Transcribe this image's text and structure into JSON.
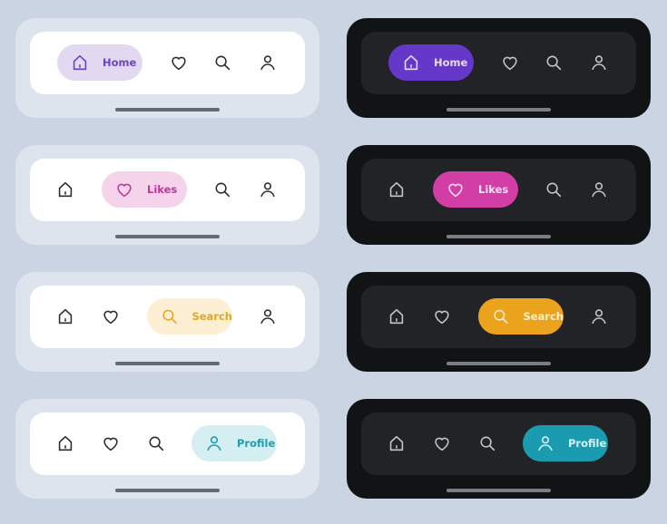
{
  "nav_items": [
    {
      "key": "home",
      "label": "Home",
      "icon": "home-icon"
    },
    {
      "key": "likes",
      "label": "Likes",
      "icon": "heart-icon"
    },
    {
      "key": "search",
      "label": "Search",
      "icon": "search-icon"
    },
    {
      "key": "profile",
      "label": "Profile",
      "icon": "user-icon"
    }
  ],
  "variants": [
    {
      "theme": "light",
      "active": "home",
      "accent": "#6a45b8",
      "pill": "#e2d8f2",
      "icon_color": "#2b2d33"
    },
    {
      "theme": "dark",
      "active": "home",
      "accent": "#e6dcfb",
      "pill": "#6638c9",
      "icon_color": "#c4c6cb"
    },
    {
      "theme": "light",
      "active": "likes",
      "accent": "#c0379a",
      "pill": "#f5d3ea",
      "icon_color": "#2b2d33"
    },
    {
      "theme": "dark",
      "active": "likes",
      "accent": "#fbe2f2",
      "pill": "#d33ea6",
      "icon_color": "#c4c6cb"
    },
    {
      "theme": "light",
      "active": "search",
      "accent": "#e6a623",
      "pill": "#fcefd3",
      "icon_color": "#2b2d33"
    },
    {
      "theme": "dark",
      "active": "search",
      "accent": "#fcefd3",
      "pill": "#eba21c",
      "icon_color": "#c4c6cb"
    },
    {
      "theme": "light",
      "active": "profile",
      "accent": "#1f9cae",
      "pill": "#d4eef1",
      "icon_color": "#2b2d33"
    },
    {
      "theme": "dark",
      "active": "profile",
      "accent": "#d8f3f6",
      "pill": "#1b9bb0",
      "icon_color": "#c4c6cb"
    }
  ]
}
